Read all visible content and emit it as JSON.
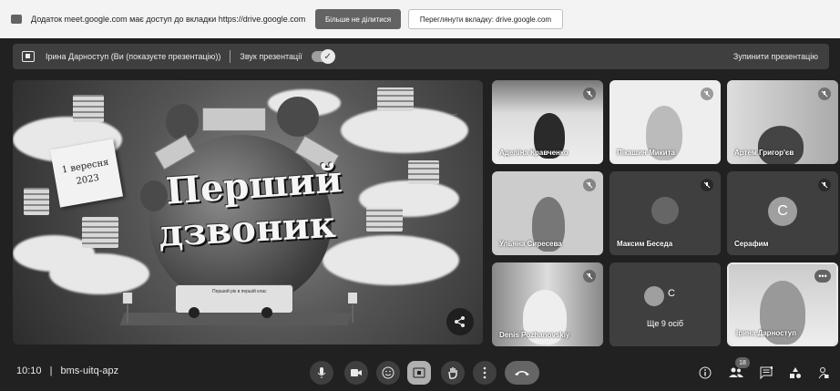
{
  "banner": {
    "message": "Додаток meet.google.com має доступ до вкладки https://drive.google.com",
    "stop_sharing": "Більше не ділитися",
    "view_tab": "Переглянути вкладку: drive.google.com"
  },
  "presenting_bar": {
    "presenter": "Ірина Дарноступ (Ви (показуєте презентацію))",
    "sound_label": "Звук презентації",
    "stop_presenting": "Зупинити презентацію"
  },
  "slide": {
    "title_line1": "Перший",
    "title_line2": "дзвоник",
    "note_line1": "1 вересня",
    "note_line2": "2023",
    "bus_text": "Перший рік в першій клас"
  },
  "participants": [
    {
      "name": "Аделіна Кравченко"
    },
    {
      "name": "Пікашин Микита"
    },
    {
      "name": "Артем Григор'єв"
    },
    {
      "name": "Ульяна Сиресева"
    },
    {
      "name": "Максим Беседа"
    },
    {
      "name": "Серафим",
      "initial": "С"
    },
    {
      "name": "Denis Pozhanovskiy"
    },
    {
      "name": "Ірина Дарноступ"
    }
  ],
  "others_tile": {
    "initial": "С",
    "label": "Ще 9 осіб"
  },
  "bottom_bar": {
    "time": "10:10",
    "separator": "|",
    "meeting_code": "bms-uitq-apz",
    "people_count": "18"
  }
}
